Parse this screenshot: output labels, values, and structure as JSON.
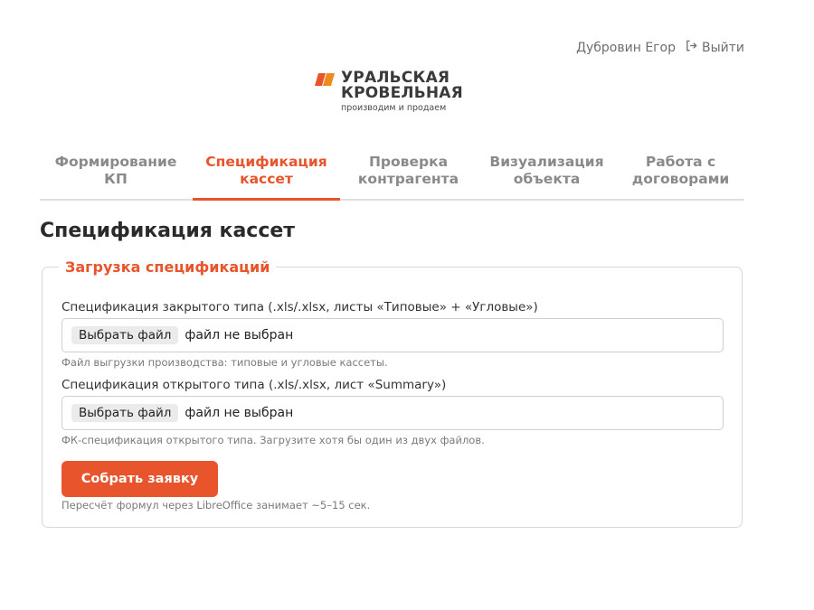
{
  "header": {
    "user_name": "Дубровин Егор",
    "logout_label": "Выйти"
  },
  "logo": {
    "line1": "УРАЛЬСКАЯ",
    "line2": "КРОВЕЛЬНАЯ",
    "tagline": "производим и продаем",
    "brand_color": "#e8542c"
  },
  "tabs": [
    {
      "line1": "Формирование",
      "line2": "КП",
      "active": false
    },
    {
      "line1": "Спецификация",
      "line2": "кассет",
      "active": true
    },
    {
      "line1": "Проверка",
      "line2": "контрагента",
      "active": false
    },
    {
      "line1": "Визуализация",
      "line2": "объекта",
      "active": false
    },
    {
      "line1": "Работа с",
      "line2": "договорами",
      "active": false
    }
  ],
  "page": {
    "title": "Спецификация кассет"
  },
  "upload": {
    "legend": "Загрузка спецификаций",
    "closed": {
      "label": "Спецификация закрытого типа (.xls/.xlsx, листы «Типовые» + «Угловые»)",
      "button": "Выбрать файл",
      "status": "файл не выбран",
      "hint": "Файл выгрузки производства: типовые и угловые кассеты."
    },
    "open": {
      "label": "Спецификация открытого типа (.xls/.xlsx, лист «Summary»)",
      "button": "Выбрать файл",
      "status": "файл не выбран",
      "hint": "ФК-спецификация открытого типа. Загрузите хотя бы один из двух файлов."
    },
    "submit_label": "Собрать заявку",
    "note": "Пересчёт формул через LibreOffice занимает ~5–15 сек."
  }
}
